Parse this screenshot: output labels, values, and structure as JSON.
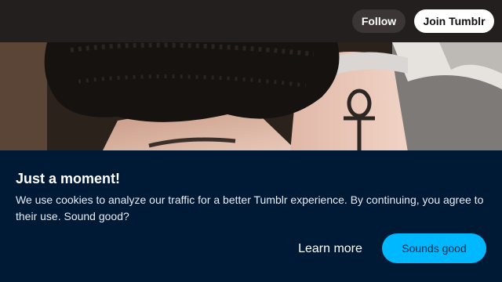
{
  "header": {
    "follow_label": "Follow",
    "join_label": "Join Tumblr"
  },
  "post": {
    "image_alt": "photo"
  },
  "cookie_banner": {
    "title": "Just a moment!",
    "message": "We use cookies to analyze our traffic for a better Tumblr experience. By continuing, you agree to their use. Sound good?",
    "learn_more_label": "Learn more",
    "accept_label": "Sounds good"
  },
  "colors": {
    "header_bg": "#231f1f",
    "banner_bg": "#001935",
    "accent": "#00b8ff"
  }
}
